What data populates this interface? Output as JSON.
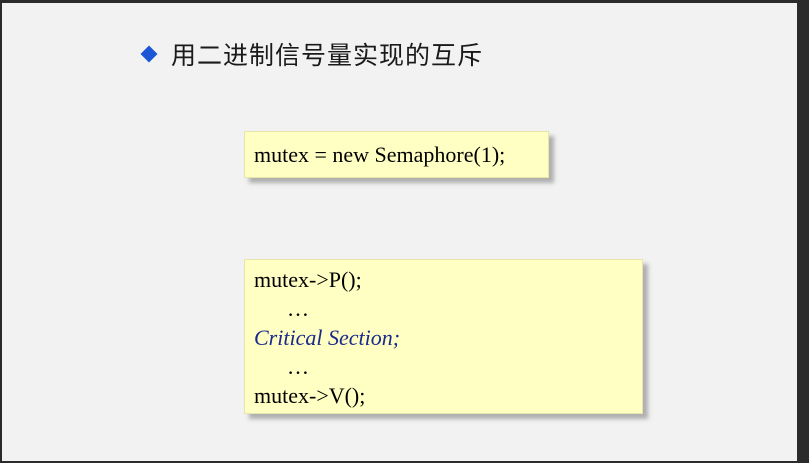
{
  "slide": {
    "title": "用二进制信号量实现的互斥",
    "bullet_icon": "diamond-bullet-icon",
    "accent_color": "#1a56d6"
  },
  "code_box_1": {
    "lines": [
      "mutex = new Semaphore(1);"
    ]
  },
  "code_box_2": {
    "lines": [
      "mutex->P();",
      "…",
      "Critical Section;",
      "…",
      "mutex->V();"
    ]
  }
}
